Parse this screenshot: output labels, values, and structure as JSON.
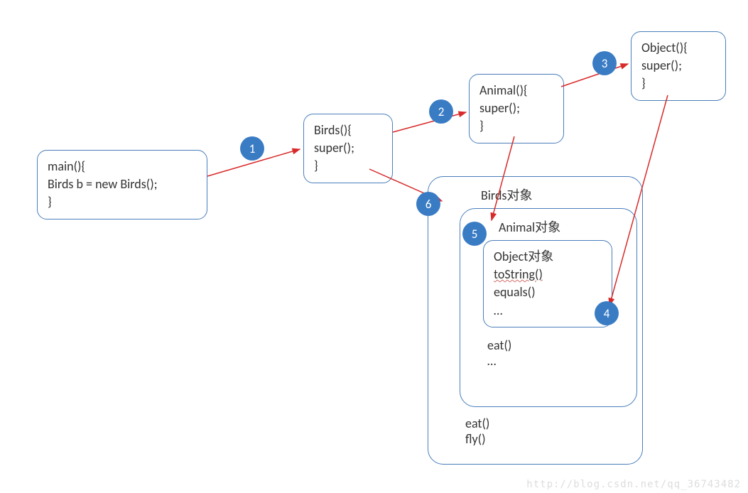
{
  "boxes": {
    "main": {
      "l1": "main(){",
      "l2": " Birds b = new Birds();",
      "l3": "}"
    },
    "birds": {
      "l1": "Birds(){",
      "l2": " super();",
      "l3": "}"
    },
    "animal": {
      "l1": "Animal(){",
      "l2": " super();",
      "l3": "}"
    },
    "object": {
      "l1": "Object(){",
      "l2": " super();",
      "l3": "}"
    }
  },
  "nested": {
    "birds_label": "Birds对象",
    "animal_label": "Animal对象",
    "object_label": "Object对象",
    "object_methods": {
      "m1": "toString()",
      "m2": "equals()",
      "m3": "…"
    },
    "animal_methods": {
      "m1": "eat()",
      "m2": "…"
    },
    "birds_methods": {
      "m1": "eat()",
      "m2": "fly()"
    }
  },
  "steps": {
    "s1": "1",
    "s2": "2",
    "s3": "3",
    "s4": "4",
    "s5": "5",
    "s6": "6"
  },
  "watermark": "http://blog.csdn.net/qq_36743482"
}
